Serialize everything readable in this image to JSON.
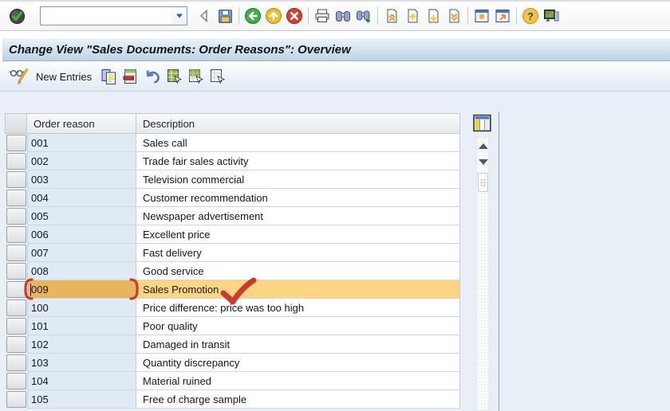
{
  "window": {
    "title": "Change View \"Sales Documents: Order Reasons\": Overview"
  },
  "toolbar": {
    "command_field": {
      "value": "",
      "placeholder": ""
    },
    "buttons": [
      "enter",
      "command-field",
      "command-dropdown",
      "collapse-command-field",
      "save",
      "back",
      "exit",
      "cancel",
      "print",
      "find",
      "find-next",
      "first-page",
      "previous-page",
      "next-page",
      "last-page",
      "new-session",
      "create-shortcut",
      "help",
      "customize-layout"
    ]
  },
  "app_toolbar": {
    "new_entries_label": "New Entries",
    "buttons": [
      "display-change-toggle",
      "new-entries",
      "copy-as",
      "delete-line",
      "undo",
      "select-all",
      "select-block",
      "deselect-all"
    ]
  },
  "table": {
    "columns": [
      "Order reason",
      "Description"
    ],
    "rows": [
      {
        "code": "001",
        "description": "Sales call",
        "selected": false
      },
      {
        "code": "002",
        "description": "Trade fair sales activity",
        "selected": false
      },
      {
        "code": "003",
        "description": "Television commercial",
        "selected": false
      },
      {
        "code": "004",
        "description": "Customer recommendation",
        "selected": false
      },
      {
        "code": "005",
        "description": "Newspaper advertisement",
        "selected": false
      },
      {
        "code": "006",
        "description": "Excellent price",
        "selected": false
      },
      {
        "code": "007",
        "description": "Fast delivery",
        "selected": false
      },
      {
        "code": "008",
        "description": "Good service",
        "selected": false
      },
      {
        "code": "009",
        "description": "Sales Promotion",
        "selected": true
      },
      {
        "code": "100",
        "description": "Price difference: price was too high",
        "selected": false
      },
      {
        "code": "101",
        "description": "Poor quality",
        "selected": false
      },
      {
        "code": "102",
        "description": "Damaged in transit",
        "selected": false
      },
      {
        "code": "103",
        "description": "Quantity discrepancy",
        "selected": false
      },
      {
        "code": "104",
        "description": "Material ruined",
        "selected": false
      },
      {
        "code": "105",
        "description": "Free of charge sample",
        "selected": false
      }
    ]
  },
  "annotations": {
    "marked_row_code": "009",
    "marks": [
      "left-bracket",
      "right-bracket",
      "checkmark"
    ],
    "color": "#cb3a2d"
  },
  "colors": {
    "selected_cell_bg": "#e8b45c",
    "selected_row_bg": "#fcd583",
    "key_column_bg": "#dfeaf4",
    "title_bar_top": "#eaf2f9",
    "title_bar_bottom": "#bed3e3",
    "content_bg": "#e9eff6"
  }
}
